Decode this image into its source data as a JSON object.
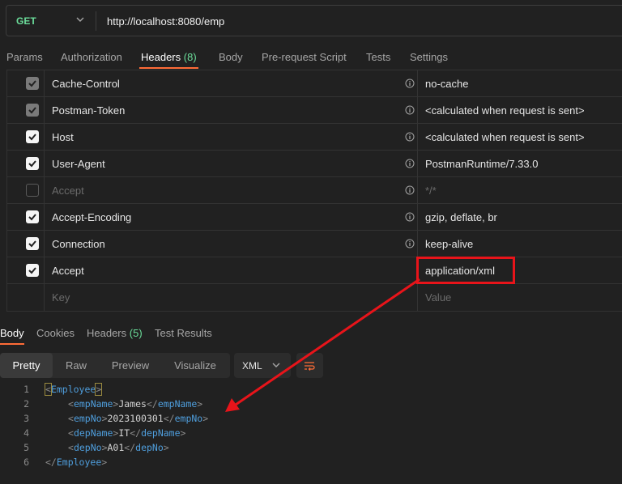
{
  "request": {
    "method": "GET",
    "url": "http://localhost:8080/emp"
  },
  "request_tabs": [
    {
      "label": "Params"
    },
    {
      "label": "Authorization"
    },
    {
      "label": "Headers",
      "count": "(8)"
    },
    {
      "label": "Body"
    },
    {
      "label": "Pre-request Script"
    },
    {
      "label": "Tests"
    },
    {
      "label": "Settings"
    }
  ],
  "headers": [
    {
      "key": "Cache-Control",
      "value": "no-cache",
      "checked": "dim"
    },
    {
      "key": "Postman-Token",
      "value": "<calculated when request is sent>",
      "checked": "dim"
    },
    {
      "key": "Host",
      "value": "<calculated when request is sent>",
      "checked": "on"
    },
    {
      "key": "User-Agent",
      "value": "PostmanRuntime/7.33.0",
      "checked": "on"
    },
    {
      "key": "Accept",
      "value": "*/*",
      "checked": "off"
    },
    {
      "key": "Accept-Encoding",
      "value": "gzip, deflate, br",
      "checked": "on"
    },
    {
      "key": "Connection",
      "value": "keep-alive",
      "checked": "on"
    },
    {
      "key": "Accept",
      "value": "application/xml",
      "checked": "on"
    }
  ],
  "new_header": {
    "key_placeholder": "Key",
    "value_placeholder": "Value"
  },
  "response_tabs": [
    {
      "label": "Body"
    },
    {
      "label": "Cookies"
    },
    {
      "label": "Headers",
      "count": "(5)"
    },
    {
      "label": "Test Results"
    }
  ],
  "view_modes": [
    "Pretty",
    "Raw",
    "Preview",
    "Visualize"
  ],
  "format": "XML",
  "code": {
    "lines": [
      "1",
      "2",
      "3",
      "4",
      "5",
      "6"
    ],
    "root_tag": "Employee",
    "fields": [
      {
        "tag": "empName",
        "value": "James"
      },
      {
        "tag": "empNo",
        "value": "2023100301"
      },
      {
        "tag": "depName",
        "value": "IT"
      },
      {
        "tag": "depNo",
        "value": "A01"
      }
    ]
  },
  "colors": {
    "accent": "#ff6c37",
    "method": "#6bdd9a",
    "annotation": "#e8141a",
    "xml_tag": "#4f9fde"
  }
}
